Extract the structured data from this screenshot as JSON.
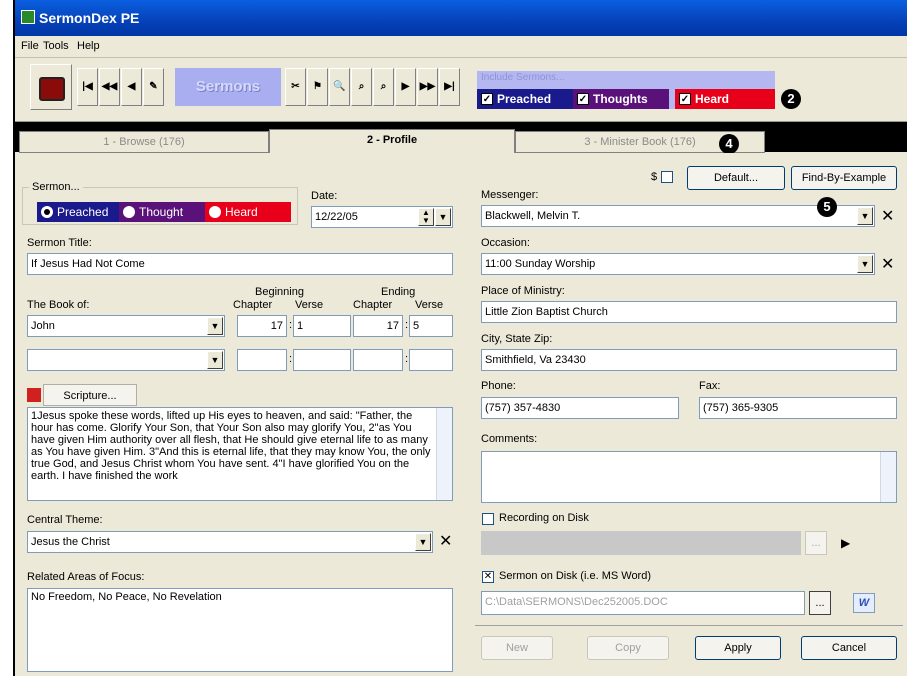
{
  "window": {
    "title": "SermonDex PE"
  },
  "menu": {
    "file": "File",
    "tools": "Tools",
    "help": "Help"
  },
  "toolbar": {
    "sermons_label": "Sermons",
    "include_label": "Include Sermons...",
    "preached": "Preached",
    "thoughts": "Thoughts",
    "heard": "Heard",
    "nav": [
      "|◀",
      "◀◀",
      "◀"
    ],
    "nav2": [
      "▶",
      "▶▶",
      "▶|"
    ]
  },
  "callouts": {
    "two": "2",
    "four": "4",
    "five": "5"
  },
  "tabs": [
    "1 - Browse (176)",
    "2 - Profile",
    "3 - Minister Book (176)"
  ],
  "left": {
    "sermon_group": "Sermon...",
    "radio_preached": "Preached",
    "radio_thought": "Thought",
    "radio_heard": "Heard",
    "date_label": "Date:",
    "date_value": "12/22/05",
    "title_label": "Sermon Title:",
    "title_value": "If Jesus Had Not Come",
    "book_label": "The Book of:",
    "beginning": "Beginning",
    "ending": "Ending",
    "chapter": "Chapter",
    "verse": "Verse",
    "book1": "John",
    "begin_ch": "17",
    "begin_vs": "1",
    "end_ch": "17",
    "end_vs": "5",
    "colon": ":",
    "dash": "–",
    "scripture_btn": "Scripture...",
    "scripture_text": "1Jesus spoke these words, lifted up His eyes to heaven, and said: \"Father, the hour has come. Glorify Your Son, that Your Son also may glorify You, 2\"as You have given Him authority over all flesh, that He should give eternal life to as many as You have given Him. 3\"And this is eternal life, that they may know You, the only true God, and Jesus Christ whom You have sent. 4\"I have glorified You on the earth. I have finished the work",
    "theme_label": "Central Theme:",
    "theme_value": "Jesus the Christ",
    "focus_label": "Related Areas of Focus:",
    "focus_value": "No Freedom, No Peace, No Revelation"
  },
  "right": {
    "dollar": "$",
    "default_btn": "Default...",
    "find_btn": "Find-By-Example",
    "messenger_label": "Messenger:",
    "messenger_value": "Blackwell, Melvin T.",
    "occasion_label": "Occasion:",
    "occasion_value": "11:00 Sunday Worship",
    "place_label": "Place of Ministry:",
    "place_value": "Little Zion Baptist Church",
    "city_label": "City, State Zip:",
    "city_value": "Smithfield, Va 23430",
    "phone_label": "Phone:",
    "phone_value": "(757) 357-4830",
    "fax_label": "Fax:",
    "fax_value": "(757) 365-9305",
    "comments_label": "Comments:",
    "recording_label": "Recording on Disk",
    "disk_label": "Sermon on Disk  (i.e. MS Word)",
    "disk_path": "C:\\Data\\SERMONS\\Dec252005.DOC",
    "ellipsis": "...",
    "word_icon": "W"
  },
  "buttons": {
    "new": "New",
    "copy": "Copy",
    "apply": "Apply",
    "cancel": "Cancel"
  }
}
